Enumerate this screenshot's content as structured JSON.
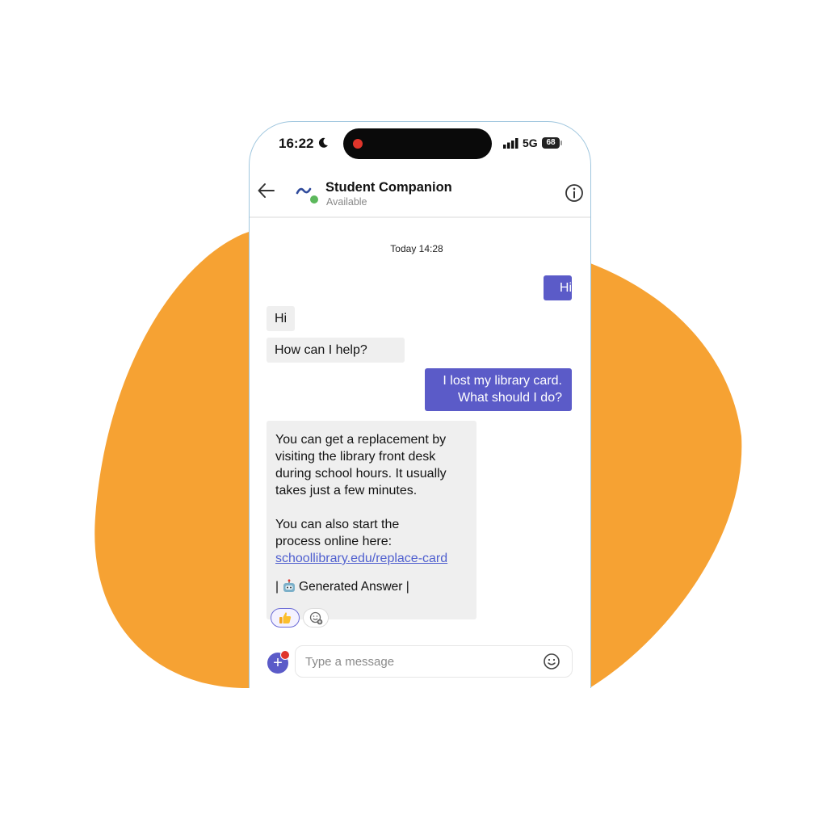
{
  "colors": {
    "blob": "#f6a233",
    "accent": "#5b5bc8",
    "incoming_bubble": "#efefef",
    "link": "#4f5fcf",
    "presence": "#5cb85c"
  },
  "status_bar": {
    "time": "16:22",
    "network": "5G",
    "battery": "68"
  },
  "header": {
    "title": "Student Companion",
    "presence": "Available"
  },
  "chat": {
    "timestamp": "Today 14:28",
    "messages": [
      {
        "from": "user",
        "text": "Hi"
      },
      {
        "from": "bot",
        "text": "Hi"
      },
      {
        "from": "bot",
        "text": "How can I help?"
      },
      {
        "from": "user",
        "lines": [
          "I lost my library card.",
          "What should I do?"
        ]
      },
      {
        "from": "bot",
        "lines": [
          "You can get a replacement by",
          "visiting the library front desk",
          "during school hours. It usually",
          "takes just a few minutes."
        ],
        "lines2": [
          "You can also start the",
          "process online here:"
        ],
        "link": "schoollibrary.edu/replace-card",
        "tag": "Generated Answer"
      }
    ]
  },
  "icons": {
    "moon": "moon-icon",
    "signal": "signal-icon",
    "back": "back-arrow-icon",
    "info": "info-icon",
    "thumb": "thumbs-up-icon",
    "add_reaction": "add-reaction-icon",
    "bot_face": "robot-face-icon",
    "emoji": "emoji-icon",
    "plus": "plus-icon"
  },
  "composer": {
    "placeholder": "Type a message"
  }
}
